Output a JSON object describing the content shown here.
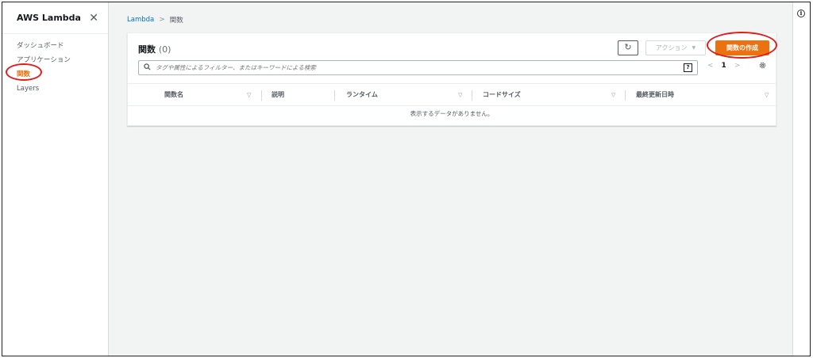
{
  "sidebar": {
    "title": "AWS Lambda",
    "close_glyph": "✕",
    "items": [
      {
        "label": "ダッシュボード",
        "active": false
      },
      {
        "label": "アプリケーション",
        "active": false
      },
      {
        "label": "関数",
        "active": true
      },
      {
        "label": "Layers",
        "active": false
      }
    ]
  },
  "breadcrumb": {
    "root": "Lambda",
    "separator": ">",
    "current": "関数"
  },
  "panel": {
    "title": "関数",
    "count": "(0)",
    "refresh_glyph": "↻",
    "action_label": "アクション",
    "action_caret": "▼",
    "create_label": "関数の作成",
    "search_placeholder": "タグや属性によるフィルター、またはキーワードによる検索",
    "help_glyph": "?",
    "pager": {
      "prev": "<",
      "page": "1",
      "next": ">"
    },
    "columns": [
      {
        "label": "関数名",
        "sortable": true
      },
      {
        "label": "説明",
        "sortable": false
      },
      {
        "label": "ランタイム",
        "sortable": true
      },
      {
        "label": "コードサイズ",
        "sortable": true
      },
      {
        "label": "最終更新日時",
        "sortable": true
      }
    ],
    "sort_glyph": "▽",
    "empty_message": "表示するデータがありません。"
  },
  "info_glyph": "i",
  "colors": {
    "accent": "#ec7211",
    "link": "#0073bb",
    "annotation": "#e21b1b"
  }
}
